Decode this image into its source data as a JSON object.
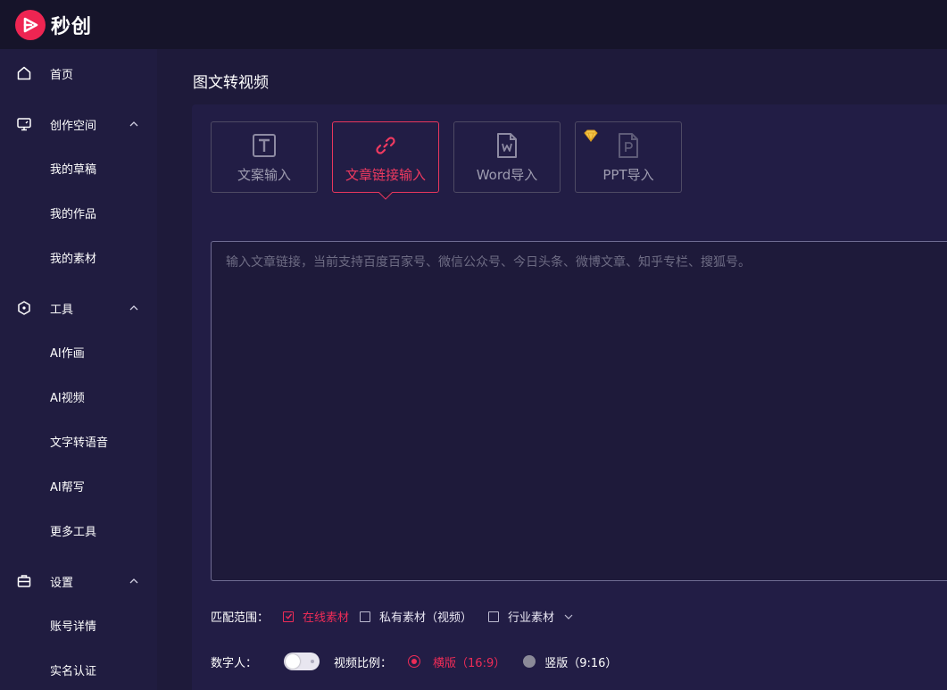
{
  "app": {
    "name": "秒创",
    "brand_color": "#ee2552"
  },
  "sidebar": {
    "groups": [
      {
        "label": "首页",
        "icon": "home-icon"
      },
      {
        "label": "创作空间",
        "icon": "monitor-icon",
        "items": [
          "我的草稿",
          "我的作品",
          "我的素材"
        ]
      },
      {
        "label": "工具",
        "icon": "tool-hexagon-icon",
        "items": [
          "AI作画",
          "AI视频",
          "文字转语音",
          "AI帮写",
          "更多工具"
        ]
      },
      {
        "label": "设置",
        "icon": "briefcase-icon",
        "items": [
          "账号详情",
          "实名认证"
        ]
      }
    ]
  },
  "main": {
    "title": "图文转视频",
    "tabs": [
      {
        "label": "文案输入",
        "icon": "text-t-icon",
        "active": false
      },
      {
        "label": "文章链接输入",
        "icon": "link-icon",
        "active": true
      },
      {
        "label": "Word导入",
        "icon": "word-file-icon",
        "active": false
      },
      {
        "label": "PPT导入",
        "icon": "ppt-file-icon",
        "active": false,
        "vip": true
      }
    ],
    "input": {
      "placeholder": "输入文章链接，当前支持百度百家号、微信公众号、今日头条、微博文章、知乎专栏、搜狐号。",
      "value": ""
    },
    "match_range": {
      "label": "匹配范围：",
      "options": [
        {
          "label": "在线素材",
          "checked": true
        },
        {
          "label": "私有素材（视频）",
          "checked": false
        },
        {
          "label": "行业素材",
          "checked": false
        }
      ]
    },
    "digital_human": {
      "label": "数字人：",
      "enabled": false
    },
    "video_ratio": {
      "label": "视频比例：",
      "options": [
        {
          "label": "横版（16:9）",
          "selected": true
        },
        {
          "label": "竖版（9:16）",
          "selected": false
        }
      ]
    }
  },
  "colors": {
    "accent": "#ee2c57",
    "sidebar_bg": "#201c40",
    "topbar_bg": "#16142a",
    "panel_bg": "#221d45"
  }
}
